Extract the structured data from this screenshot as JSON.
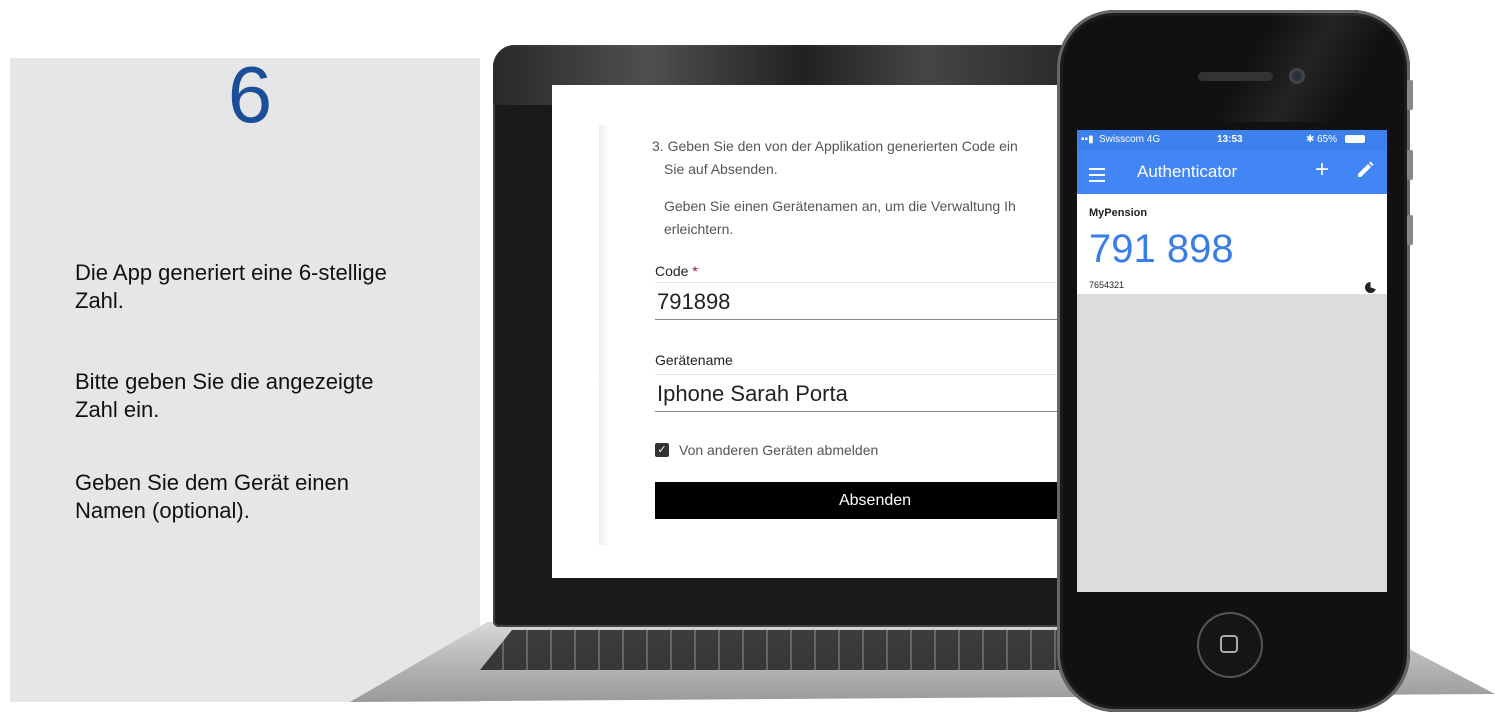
{
  "info": {
    "step": "6",
    "line1": "Die App generiert eine 6-stellige",
    "line2": "Zahl.",
    "line3": "Bitte geben Sie die angezeigte",
    "line4": "Zahl ein.",
    "line5": "Geben Sie dem Gerät einen",
    "line6": "Namen (optional)."
  },
  "laptop": {
    "instruction1": "3. Geben Sie den von der Applikation generierten Code ein",
    "instruction2": "Sie auf Absenden.",
    "instruction3": "Geben Sie einen Gerätenamen an, um die Verwaltung Ih",
    "instruction4": "erleichtern.",
    "code_label": "Code",
    "required_mark": "*",
    "code_value": "791898",
    "device_label": "Gerätename",
    "device_value": "Iphone Sarah Porta",
    "checkbox_label": "Von anderen Geräten abmelden",
    "checkbox_checked": true,
    "submit_label": "Absenden"
  },
  "phone": {
    "carrier": "Swisscom  4G",
    "time": "13:53",
    "battery": "65%",
    "app_title": "Authenticator",
    "account_name": "MyPension",
    "otp_code": "791 898",
    "account_user": "7654321",
    "accent_color": "#4285f4"
  }
}
